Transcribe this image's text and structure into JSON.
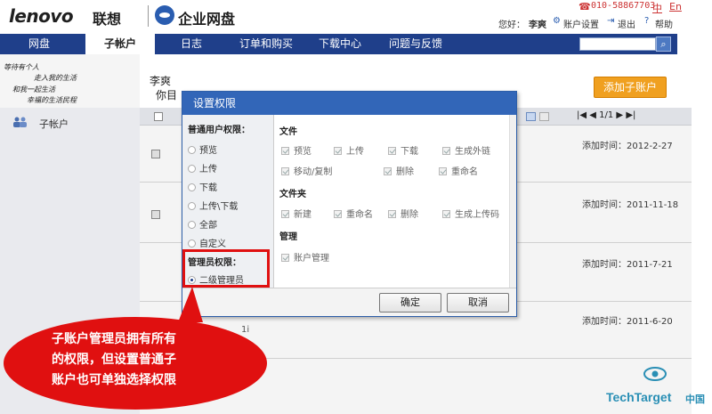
{
  "header": {
    "brand": "lenovo",
    "brand_cn": "联想",
    "product": "企业网盘",
    "phone": "010-58867703",
    "lang_zh": "中",
    "lang_en": "En",
    "welcome": "您好：",
    "username": "李爽",
    "account_settings": "账户设置",
    "logout": "退出",
    "help": "帮助"
  },
  "nav": {
    "items": [
      "网盘",
      "子帐户",
      "日志",
      "订单和购买",
      "下载中心",
      "问题与反馈"
    ],
    "active_index": 1,
    "search_placeholder": ""
  },
  "sidebar": {
    "note_lines": [
      "等待有个人",
      "走入我的生活",
      "和我一起生活",
      "幸福的生活民程"
    ],
    "item_label": "子帐户"
  },
  "main": {
    "user": "李爽",
    "greeting": "你目",
    "add_button": "添加子账户",
    "pager": "1/1",
    "rows": [
      {
        "date": "添加时间：2012-2-27"
      },
      {
        "date": "添加时间：2011-11-18"
      },
      {
        "date": "添加时间：2011-7-21"
      },
      {
        "date": "添加时间：2011-6-20"
      }
    ],
    "fragment": "1i"
  },
  "dialog": {
    "title": "设置权限",
    "normal_label": "普通用户权限：",
    "normal_options": [
      "预览",
      "上传",
      "下载",
      "上传\\下载",
      "全部",
      "自定义"
    ],
    "admin_label": "管理员权限：",
    "admin_option": "二级管理员",
    "admin_selected": true,
    "file_section": "文件",
    "file_perms": [
      "预览",
      "上传",
      "下载",
      "生成外链",
      "移动/复制",
      "删除",
      "重命名"
    ],
    "folder_section": "文件夹",
    "folder_perms": [
      "新建",
      "重命名",
      "删除",
      "生成上传码"
    ],
    "manage_section": "管理",
    "manage_perms": [
      "账户管理"
    ],
    "ok": "确定",
    "cancel": "取消"
  },
  "callout": {
    "lines": [
      "子账户管理员拥有所有",
      "的权限，但设置普通子",
      "账户也可单独选择权限"
    ],
    "color": "#e01010"
  },
  "watermark": {
    "text": "TechTarget",
    "cn": "中国"
  },
  "colors": {
    "nav_bg": "#1f3f8a",
    "dialog_title_bg": "#3266b8",
    "accent_orange": "#f0a020",
    "link_red": "#cc3333"
  }
}
